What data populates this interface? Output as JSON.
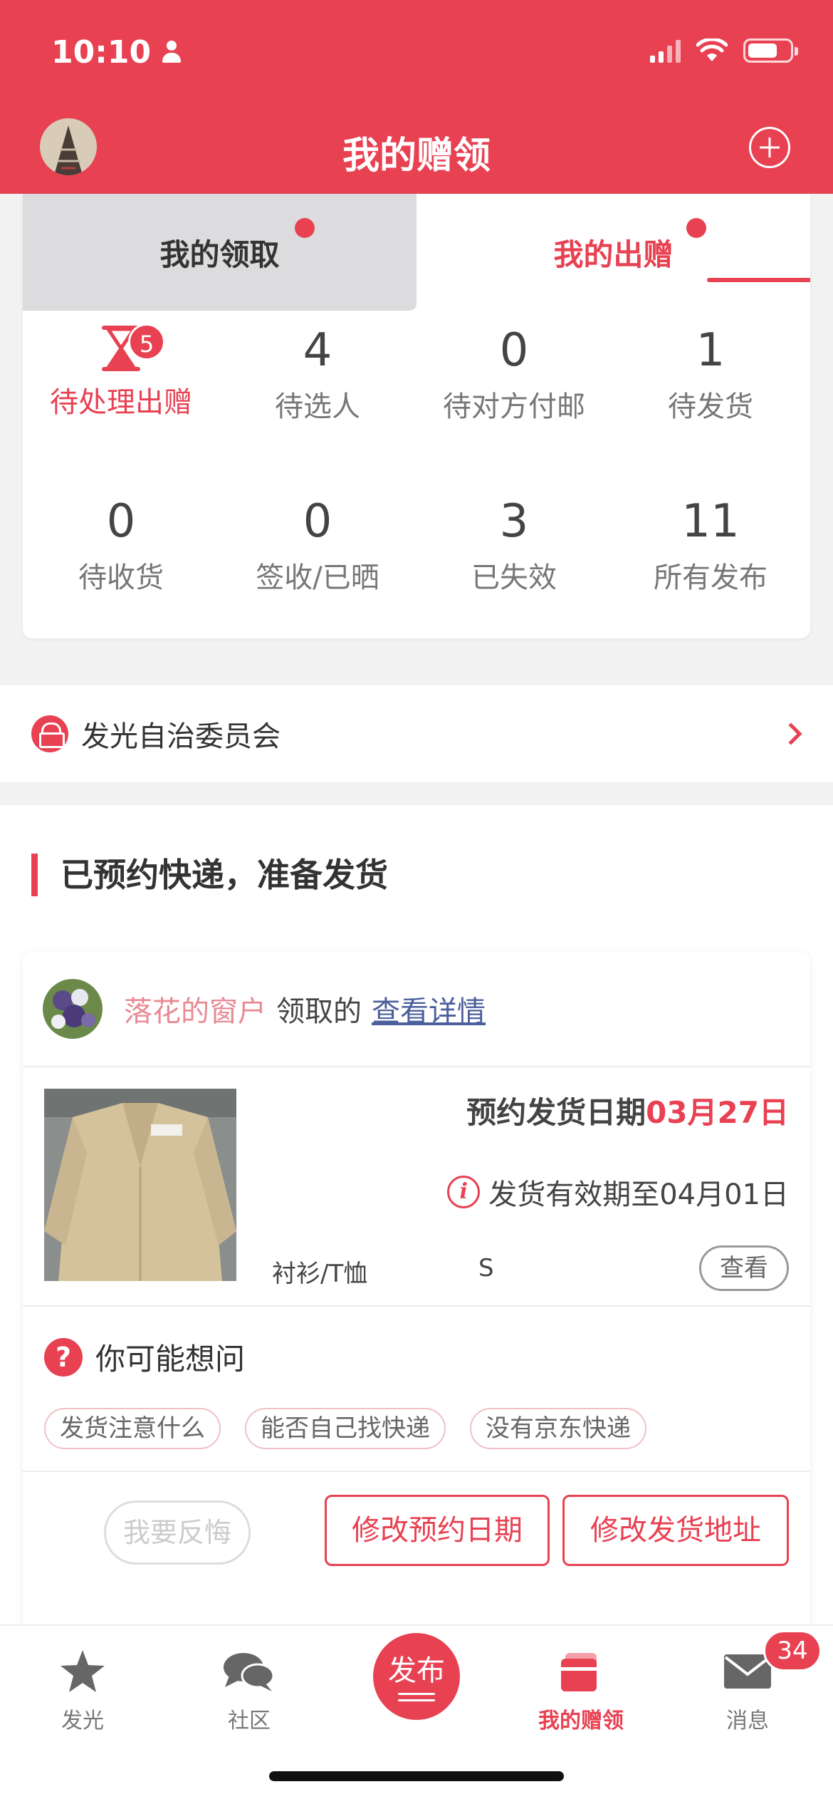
{
  "status_bar": {
    "time": "10:10"
  },
  "header": {
    "title": "我的赠领"
  },
  "tabs": [
    {
      "label": "我的领取",
      "active": false
    },
    {
      "label": "我的出赠",
      "active": true
    }
  ],
  "stats": [
    {
      "value": "",
      "label": "待处理出赠",
      "badge": "5",
      "icon": "hourglass-icon"
    },
    {
      "value": "4",
      "label": "待选人"
    },
    {
      "value": "0",
      "label": "待对方付邮"
    },
    {
      "value": "1",
      "label": "待发货"
    },
    {
      "value": "0",
      "label": "待收货"
    },
    {
      "value": "0",
      "label": "签收/已晒"
    },
    {
      "value": "3",
      "label": "已失效"
    },
    {
      "value": "11",
      "label": "所有发布"
    }
  ],
  "committee": {
    "label": "发光自治委员会"
  },
  "section": {
    "title": "已预约快递，准备发货"
  },
  "order": {
    "user_name": "落花的窗户",
    "receive_text": "领取的",
    "detail_link": "查看详情",
    "ship_date_label": "预约发货日期",
    "ship_date_value": "03月27日",
    "valid_text": "发货有效期至04月01日",
    "category": "衬衫/T恤",
    "size": "S",
    "view_label": "查看"
  },
  "faq": {
    "title": "你可能想问",
    "chips": [
      "发货注意什么",
      "能否自己找快递",
      "没有京东快递"
    ]
  },
  "actions": {
    "regret": "我要反悔",
    "change_date": "修改预约日期",
    "change_address": "修改发货地址"
  },
  "tabbar": {
    "items": [
      {
        "label": "发光",
        "icon": "star-icon"
      },
      {
        "label": "社区",
        "icon": "chat-icon"
      },
      {
        "label": "发布",
        "icon": "publish-icon"
      },
      {
        "label": "我的赠领",
        "icon": "gift-box-icon",
        "active": true
      },
      {
        "label": "消息",
        "icon": "mail-icon",
        "badge": "34"
      }
    ]
  },
  "colors": {
    "accent": "#e84152",
    "header_bg": "#e84152",
    "link": "#4a5f9c"
  }
}
